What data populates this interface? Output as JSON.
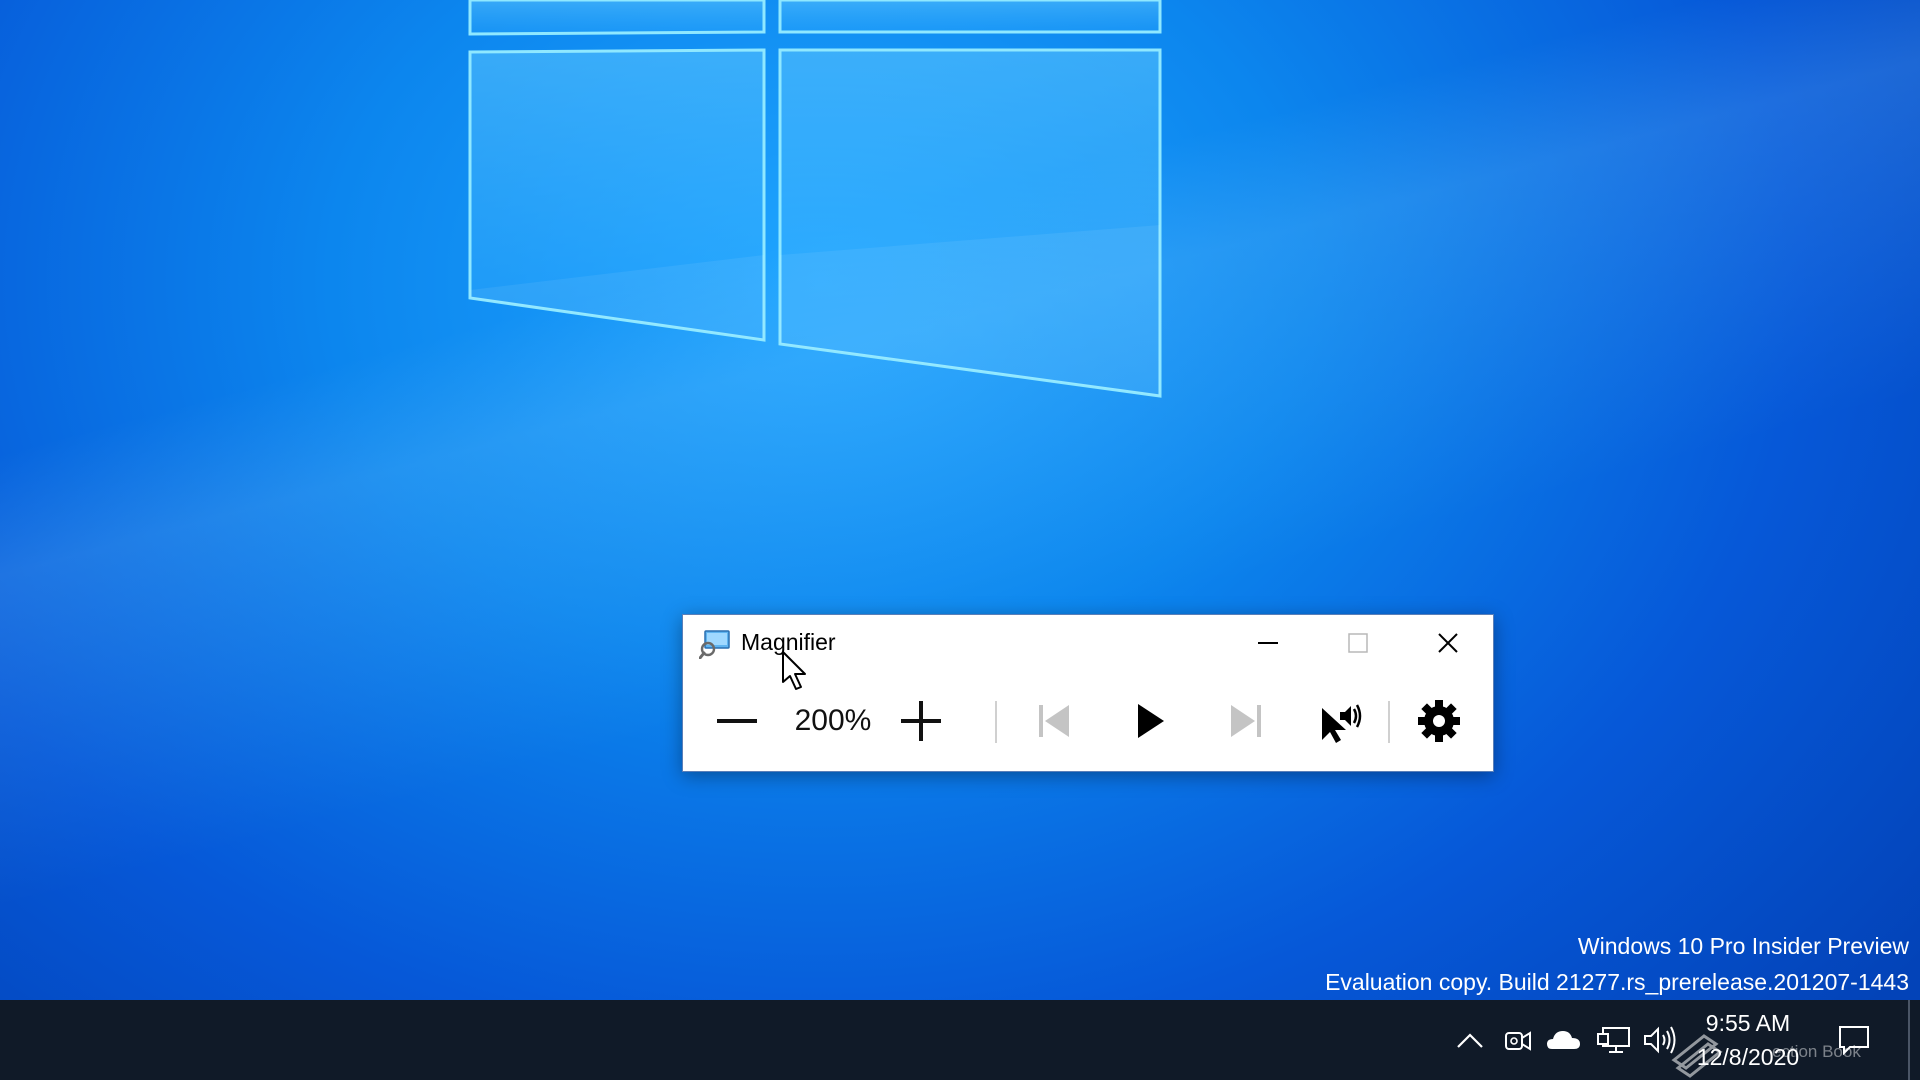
{
  "window": {
    "title": "Magnifier",
    "minimize_icon": "minimize-icon",
    "maximize_icon": "maximize-icon",
    "close_icon": "close-icon"
  },
  "toolbar": {
    "zoom_out_icon": "minus-icon",
    "zoom_level": "200%",
    "zoom_in_icon": "plus-icon",
    "previous_icon": "skip-previous-icon",
    "play_icon": "play-icon",
    "next_icon": "skip-next-icon",
    "read_from_icon": "pointer-speaker-icon",
    "settings_icon": "gear-icon"
  },
  "watermark": {
    "line1": "Windows 10 Pro Insider Preview",
    "line2": "Evaluation copy. Build 21277.rs_prerelease.201207-1443"
  },
  "taskbar": {
    "time": "9:55 AM",
    "date": "12/8/2020",
    "overlay_text": "ection Book"
  },
  "colors": {
    "desktop_bg": "#0c86ee",
    "taskbar_bg": "#101a28",
    "window_bg": "#ffffff"
  }
}
